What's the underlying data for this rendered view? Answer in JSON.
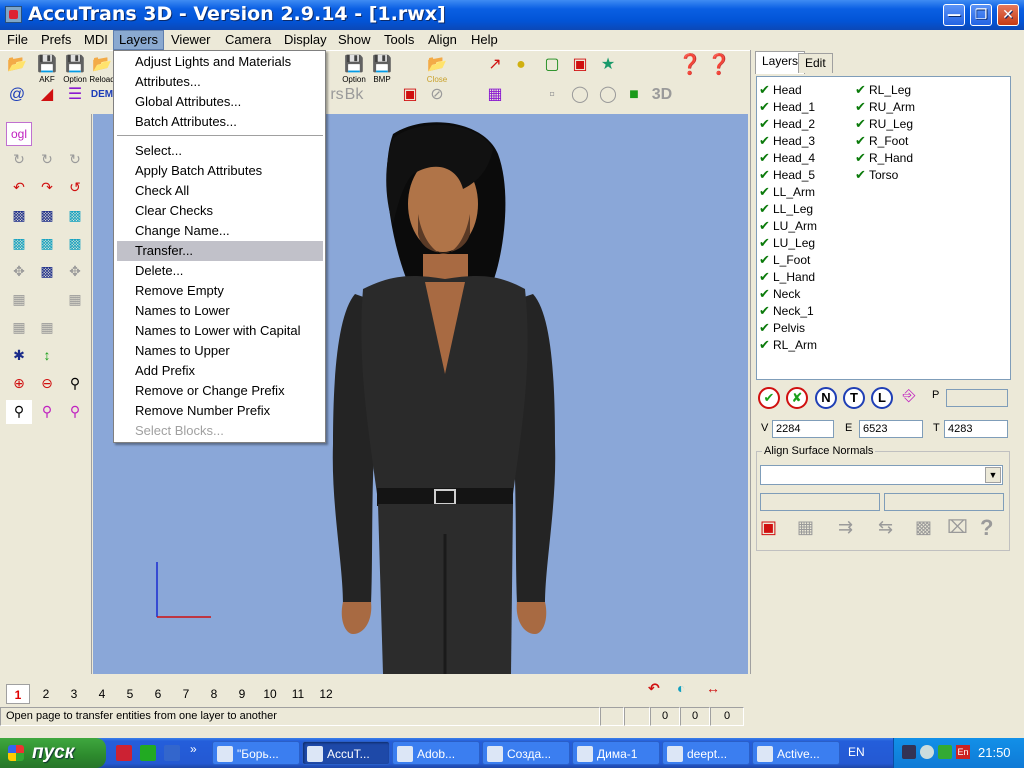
{
  "window": {
    "title": "AccuTrans 3D - Version 2.9.14 - [1.rwx]"
  },
  "menubar": {
    "items": [
      "File",
      "Prefs",
      "MDI",
      "Layers",
      "Viewer",
      "Camera",
      "Display",
      "Show",
      "Tools",
      "Align",
      "Help"
    ],
    "active": "Layers"
  },
  "toolbar": {
    "labels": {
      "akf": "AKF",
      "option": "Option",
      "reload": "Reload",
      "dem": "DEM",
      "option2": "Option",
      "bmp": "BMP",
      "close": "Close",
      "3d": "3D"
    }
  },
  "lefttools": {
    "ogl": "ogl"
  },
  "layers_menu": {
    "items": [
      {
        "label": "Adjust Lights and Materials"
      },
      {
        "label": "Attributes..."
      },
      {
        "label": "Global Attributes..."
      },
      {
        "label": "Batch Attributes..."
      },
      {
        "label": "Select..."
      },
      {
        "label": "Apply Batch Attributes"
      },
      {
        "label": "Check All"
      },
      {
        "label": "Clear Checks"
      },
      {
        "label": "Change Name..."
      },
      {
        "label": "Transfer...",
        "highlighted": true
      },
      {
        "label": "Delete..."
      },
      {
        "label": "Remove Empty"
      },
      {
        "label": "Names to Lower"
      },
      {
        "label": "Names to Lower with Capital"
      },
      {
        "label": "Names to Upper"
      },
      {
        "label": "Add Prefix"
      },
      {
        "label": "Remove or Change Prefix"
      },
      {
        "label": "Remove Number Prefix"
      },
      {
        "label": "Select Blocks...",
        "disabled": true
      }
    ]
  },
  "panel": {
    "tabs": [
      "Layers",
      "Edit"
    ],
    "layers_col1": [
      "Head",
      "Head_1",
      "Head_2",
      "Head_3",
      "Head_4",
      "Head_5",
      "LL_Arm",
      "LL_Leg",
      "LU_Arm",
      "LU_Leg",
      "L_Foot",
      "L_Hand",
      "Neck",
      "Neck_1",
      "Pelvis",
      "RL_Arm"
    ],
    "layers_col2": [
      "RL_Leg",
      "RU_Arm",
      "RU_Leg",
      "R_Foot",
      "R_Hand",
      "Torso"
    ],
    "buttons": [
      "N",
      "T",
      "L"
    ],
    "p_label": "P",
    "v_label": "V",
    "v_value": "2284",
    "e_label": "E",
    "e_value": "6523",
    "t_label": "T",
    "t_value": "4283",
    "align_group_label": "Align Surface Normals"
  },
  "pages": {
    "items": [
      "1",
      "2",
      "3",
      "4",
      "5",
      "6",
      "7",
      "8",
      "9",
      "10",
      "11",
      "12"
    ],
    "active": "1"
  },
  "status": {
    "message": "Open page to transfer entities from one layer to another",
    "values": [
      "0",
      "0",
      "0"
    ]
  },
  "taskbar": {
    "start": "пуск",
    "tasks": [
      {
        "label": "\"Борь..."
      },
      {
        "label": "AccuT...",
        "active": true
      },
      {
        "label": "Adob..."
      },
      {
        "label": "Созда..."
      },
      {
        "label": "Дима-1"
      },
      {
        "label": "deept..."
      },
      {
        "label": "Active..."
      }
    ],
    "lang": "EN",
    "tray_lang": "En",
    "clock": "21:50"
  },
  "colors": {
    "viewport_bg": "#8aa7d8",
    "menu_highlight": "#c1c1c9",
    "check_green": "#0a7a0a",
    "active_page": "#e00000"
  }
}
